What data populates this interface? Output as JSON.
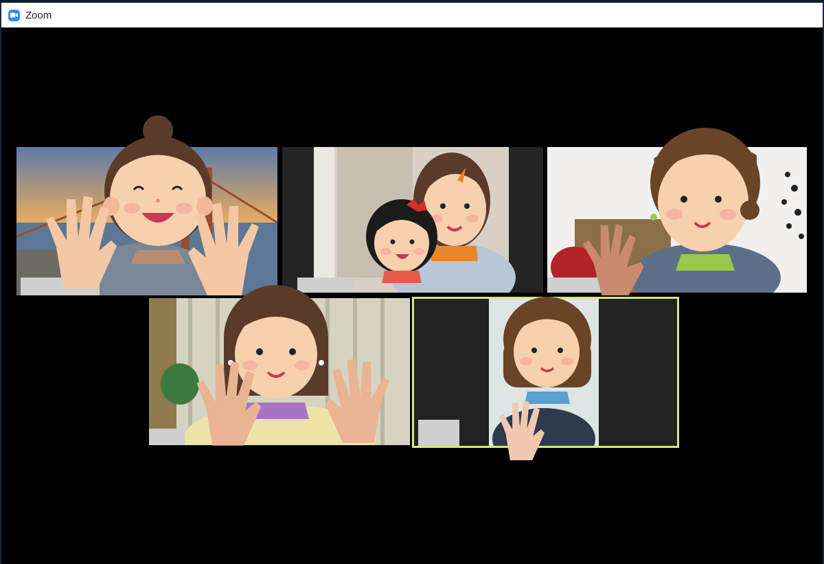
{
  "window": {
    "title": "Zoom",
    "accent": "#2d8cff"
  },
  "gallery": {
    "participants": [
      {
        "name": "",
        "video": "virtual-background-golden-gate",
        "hands_raised": true
      },
      {
        "name": "",
        "video": "room-with-door",
        "hands_raised": false
      },
      {
        "name": "",
        "video": "white-room",
        "hands_raised": true
      },
      {
        "name": "",
        "video": "curtain-room",
        "hands_raised": true
      },
      {
        "name": "",
        "video": "pillarboxed-portrait",
        "hands_raised": false,
        "active_speaker": true
      }
    ],
    "active_speaker_color": "#d6e87a"
  }
}
